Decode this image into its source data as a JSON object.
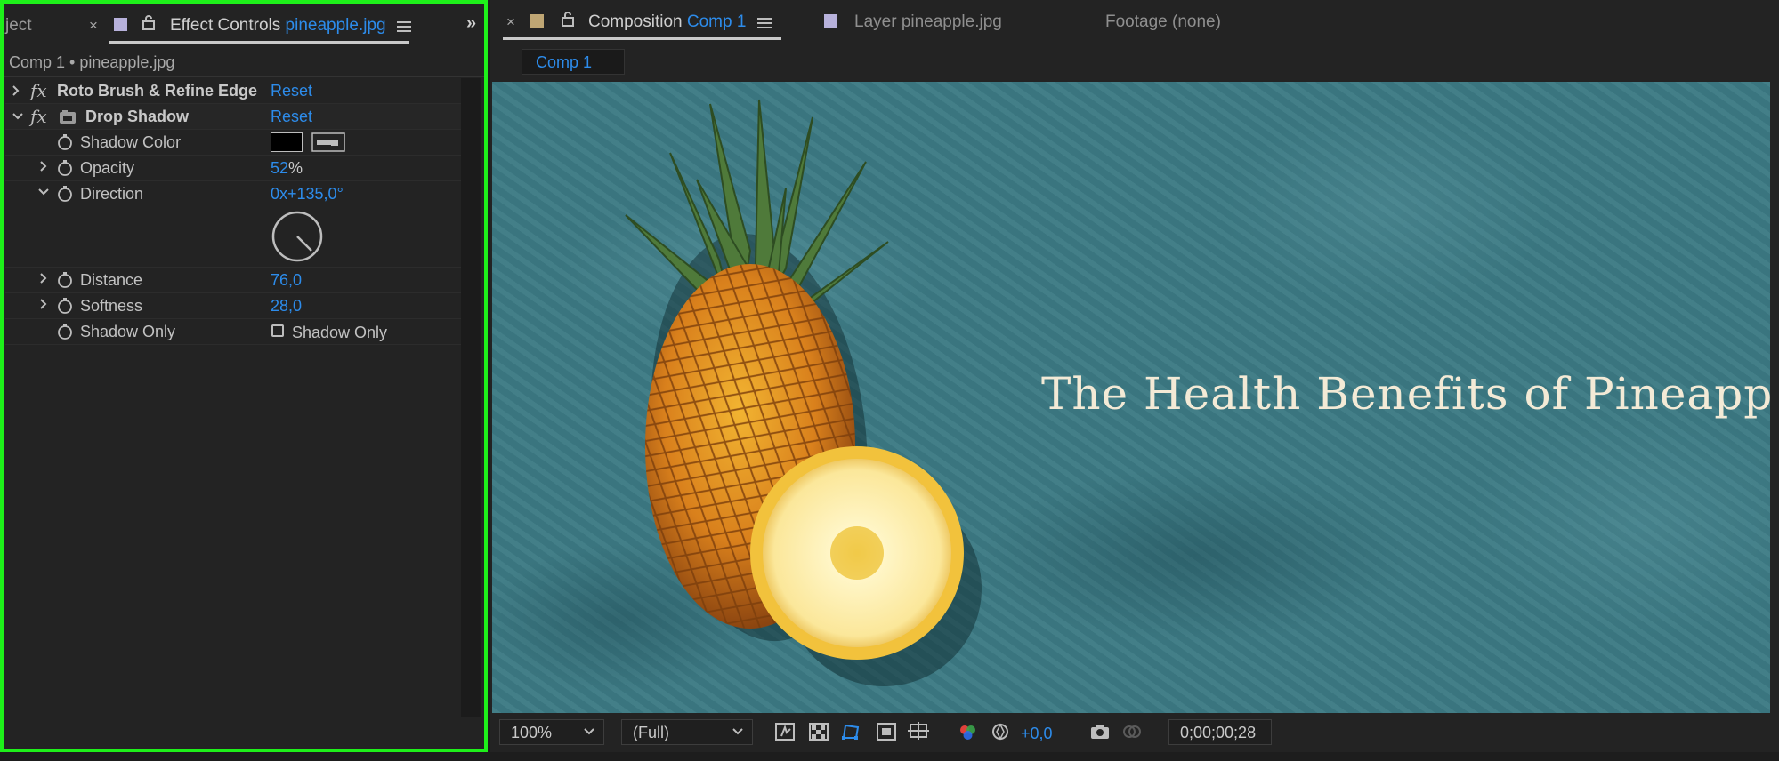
{
  "left_panel": {
    "tabs": {
      "project_partial": "ject",
      "effect_controls_label": "Effect Controls",
      "effect_controls_target": "pineapple.jpg"
    },
    "breadcrumb": "Comp 1 • pineapple.jpg",
    "effects": [
      {
        "name": "Roto Brush & Refine Edge",
        "reset": "Reset",
        "expanded": false
      },
      {
        "name": "Drop Shadow",
        "reset": "Reset",
        "expanded": true
      }
    ],
    "properties": {
      "shadow_color": {
        "label": "Shadow Color",
        "color": "#000000"
      },
      "opacity": {
        "label": "Opacity",
        "value": "52",
        "unit": "%"
      },
      "direction": {
        "label": "Direction",
        "rev": "0x",
        "angle": "+135,0°",
        "angle_value": 135
      },
      "distance": {
        "label": "Distance",
        "value": "76,0"
      },
      "softness": {
        "label": "Softness",
        "value": "28,0"
      },
      "shadow_only": {
        "label": "Shadow Only",
        "checkbox_label": "Shadow Only",
        "checked": false
      }
    }
  },
  "right_panel": {
    "tabs": {
      "composition_label": "Composition",
      "composition_name": "Comp 1",
      "layer_label": "Layer",
      "layer_name": "pineapple.jpg",
      "footage_label": "Footage (none)"
    },
    "subtab": "Comp 1",
    "viewer": {
      "title_text": "The Health Benefits of Pineapple",
      "background_color": "#3c7a84"
    },
    "bottom_bar": {
      "zoom": "100%",
      "resolution": "(Full)",
      "exposure": "+0,0",
      "timecode": "0;00;00;28"
    }
  },
  "colors": {
    "accent_blue": "#2d8ceb",
    "highlight_green": "#1ef01a",
    "panel_bg": "#232323"
  },
  "icons": [
    "close-icon",
    "lock-icon",
    "menu-icon",
    "expand-panels-icon",
    "fx-icon",
    "chevron-right-icon",
    "chevron-down-icon",
    "stopwatch-icon",
    "eyedropper-icon",
    "dial-icon",
    "checkbox-icon",
    "fast-previews-icon",
    "transparency-grid-icon",
    "mask-path-icon",
    "safe-margins-icon",
    "grid-icon",
    "channel-icon",
    "exposure-reset-icon",
    "camera-icon",
    "snapshot-show-icon"
  ]
}
